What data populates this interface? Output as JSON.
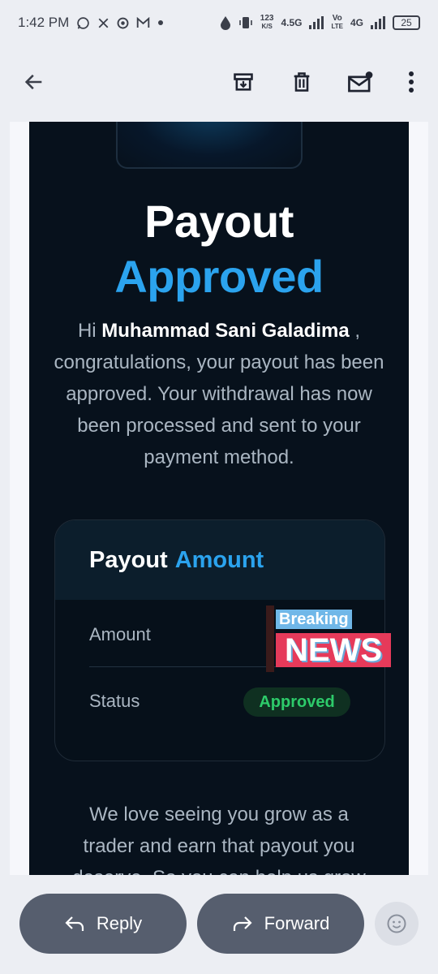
{
  "status_bar": {
    "time": "1:42 PM",
    "notification_icons": [
      "whatsapp-icon",
      "x-icon",
      "chrome-icon",
      "gmail-icon",
      "dot-icon"
    ],
    "network_speed_value": "123",
    "network_speed_unit": "K/S",
    "network_1": "4.5G",
    "volte_top": "Vo",
    "volte_bottom": "LTE",
    "network_2": "4G",
    "battery": "25"
  },
  "toolbar": {
    "icons": [
      "back-arrow-icon",
      "archive-icon",
      "delete-icon",
      "mark-unread-icon",
      "more-vert-icon"
    ]
  },
  "email": {
    "title_line1": "Payout",
    "title_line2": "Approved",
    "greeting_prefix": "Hi",
    "recipient_name": "Muhammad Sani Galadima",
    "greeting_suffix": ",",
    "intro_body": "congratulations, your payout has been approved. Your withdrawal has now been processed and sent to your payment method.",
    "card": {
      "header_word1": "Payout",
      "header_word2": "Amount",
      "amount_label": "Amount",
      "status_label": "Status",
      "status_value": "Approved"
    },
    "overlay": {
      "top": "Breaking",
      "bottom": "NEWS"
    },
    "outro": "We love seeing you grow as a trader and earn that payout you deserve. So you can help us grow"
  },
  "actions": {
    "reply_label": "Reply",
    "forward_label": "Forward"
  },
  "colors": {
    "email_bg": "#07111c",
    "accent": "#2ba3ee",
    "status_green": "#2dcb6a",
    "pill": "#565e6e"
  }
}
